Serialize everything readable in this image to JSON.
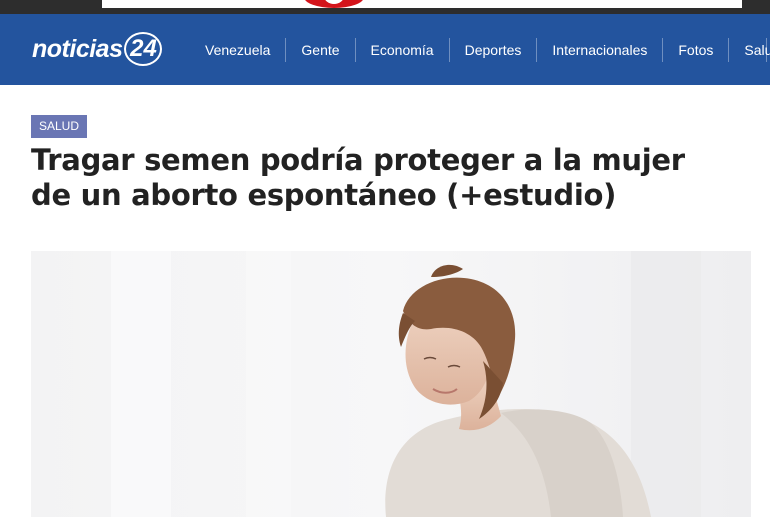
{
  "site": {
    "logo_text": "noticias",
    "logo_number": "24"
  },
  "nav": {
    "items": [
      {
        "label": "Venezuela"
      },
      {
        "label": "Gente"
      },
      {
        "label": "Economía"
      },
      {
        "label": "Deportes"
      },
      {
        "label": "Internacionales"
      },
      {
        "label": "Fotos"
      },
      {
        "label": "Salud"
      }
    ]
  },
  "article": {
    "category": "SALUD",
    "title": "Tragar semen podría proteger a la mujer de un aborto espontáneo (+estudio)"
  },
  "colors": {
    "header_bg": "#23549e",
    "category_bg": "#6a76b4",
    "title_text": "#222222"
  }
}
